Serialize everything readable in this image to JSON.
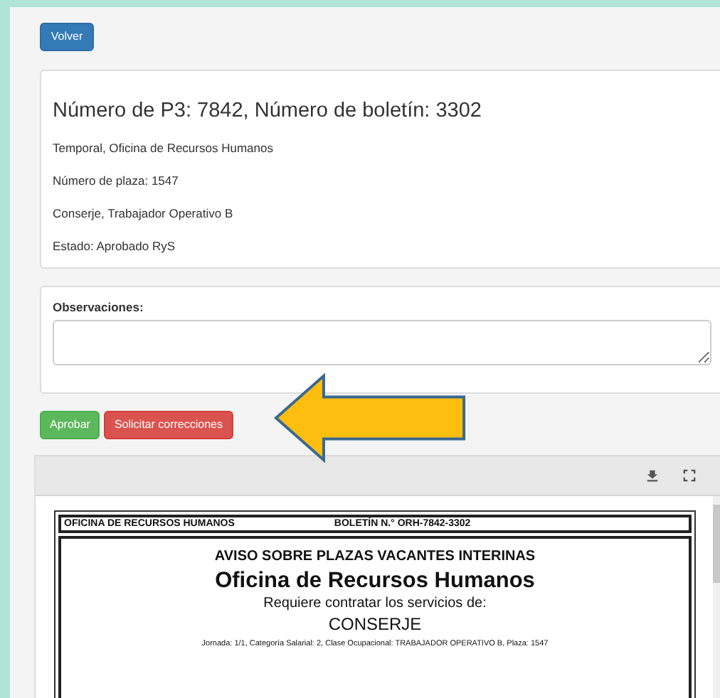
{
  "back_button": "Volver",
  "summary": {
    "title": "Número de P3: 7842, Número de boletín: 3302",
    "lines": [
      "Temporal, Oficina de Recursos Humanos",
      "Número de plaza: 1547",
      "Conserje, Trabajador Operativo B",
      "Estado: Aprobado RyS"
    ]
  },
  "observations": {
    "label": "Observaciones:"
  },
  "actions": [
    {
      "label": "Aprobar",
      "kind": "success"
    },
    {
      "label": "Solicitar correcciones",
      "kind": "danger"
    }
  ],
  "document": {
    "office": "OFICINA DE RECURSOS HUMANOS",
    "bulletin": "BOLETÍN N.° ORH-7842-3302",
    "heading": "AVISO SOBRE PLAZAS VACANTES INTERINAS",
    "title": "Oficina de Recursos Humanos",
    "subtitle": "Requiere contratar los servicios de:",
    "position": "CONSERJE",
    "details": "Jornada: 1/1, Categoría Salarial: 2, Clase Ocupacional: TRABAJADOR OPERATIVO B, Plaza: 1547"
  }
}
